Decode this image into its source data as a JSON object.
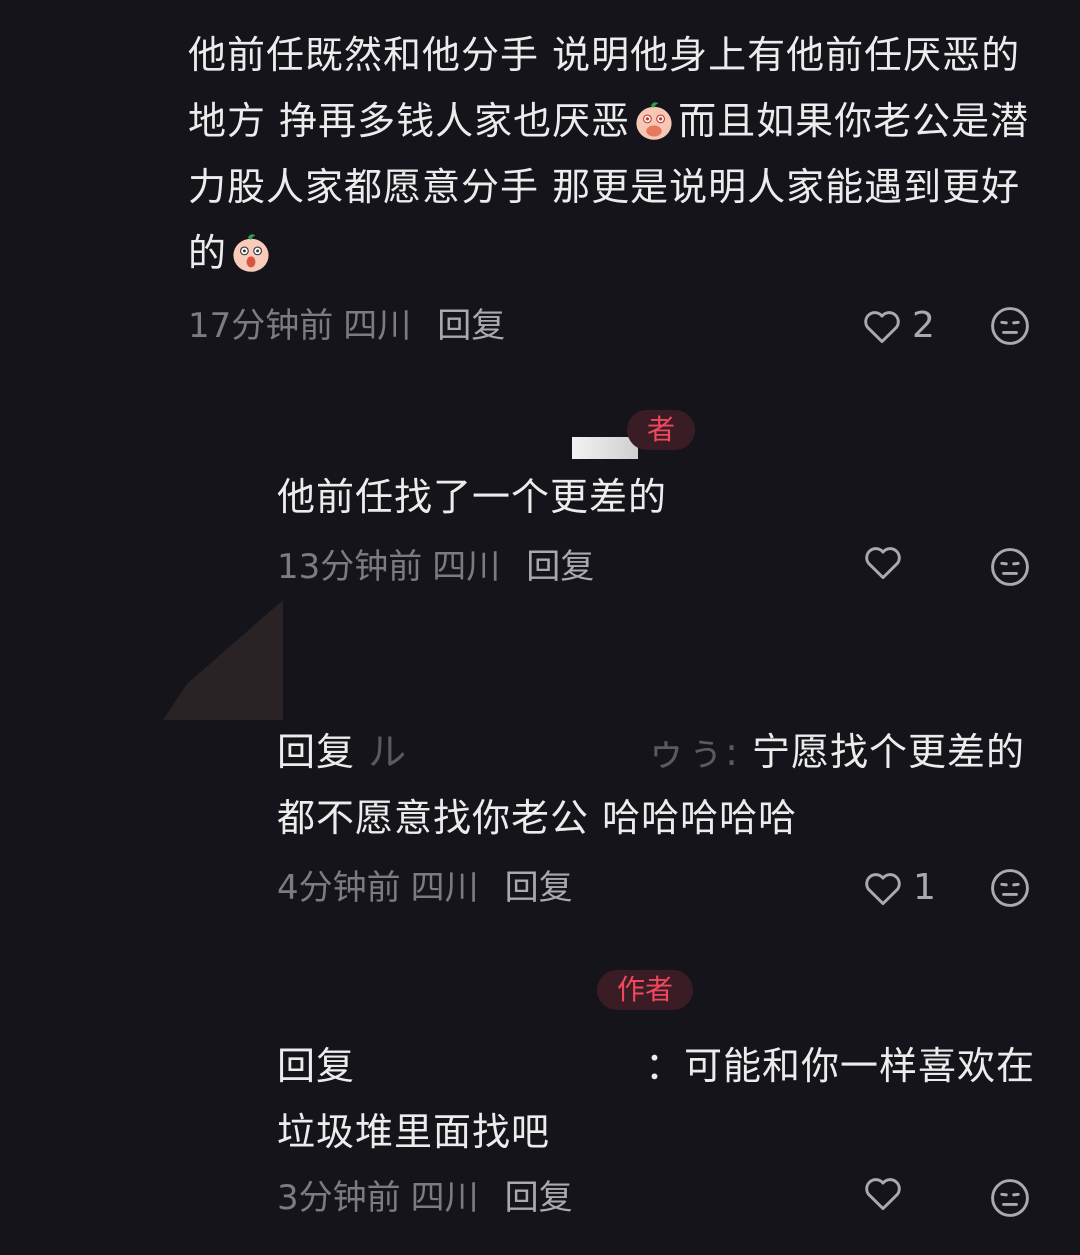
{
  "comments": [
    {
      "text_a": "他前任既然和他分手 说明他身上有他前任厌恶的地方 挣再多钱人家也厌恶",
      "emoji_a": "covering-mouth-peach-emoji",
      "text_b": "而且如果你老公是潜力股人家都愿意分手 那更是说明人家能遇到更好的",
      "emoji_b": "shocked-peach-emoji",
      "time": "17分钟前",
      "location": "四川",
      "reply_label": "回复",
      "likes": "2"
    },
    {
      "author_badge": "者",
      "text": "他前任找了一个更差的",
      "time": "13分钟前",
      "location": "四川",
      "reply_label": "回复",
      "likes": ""
    },
    {
      "prefix": "回复",
      "name_fragment_start": "ル",
      "name_fragment_end": "ゥぅ:",
      "text": "宁愿找个更差的都不愿意找你老公 哈哈哈哈哈",
      "time": "4分钟前",
      "location": "四川",
      "reply_label": "回复",
      "likes": "1"
    },
    {
      "author_badge": "作者",
      "prefix": "回复",
      "colon": "：",
      "text": "可能和你一样喜欢在垃圾堆里面找吧",
      "time": "3分钟前",
      "location": "四川",
      "reply_label": "回复",
      "likes": ""
    }
  ],
  "colors": {
    "background": "#16141b",
    "text": "#ececec",
    "meta": "#7b7b82",
    "author_badge": "#f0485e"
  }
}
